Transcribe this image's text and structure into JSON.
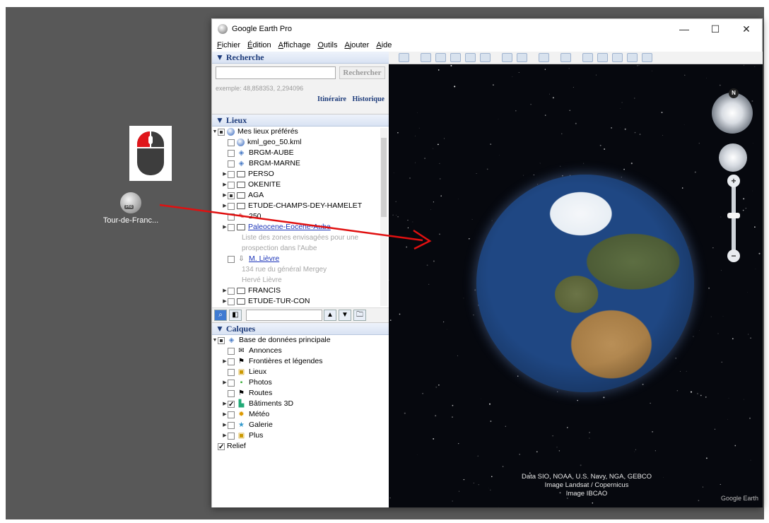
{
  "desktop": {
    "shortcut_label": "Tour-de-Franc...",
    "arrow_color": "#e01010"
  },
  "window": {
    "title": "Google Earth Pro",
    "controls": {
      "minimize": "—",
      "maximize": "☐",
      "close": "✕"
    },
    "menu": [
      "Fichier",
      "Édition",
      "Affichage",
      "Outils",
      "Ajouter",
      "Aide"
    ]
  },
  "search": {
    "header": "▼ Recherche",
    "input_value": "",
    "button": "Rechercher",
    "example": "exemple: 48,858353, 2,294096",
    "link_itinerary": "Itinéraire",
    "link_history": "Historique"
  },
  "places": {
    "header": "▼ Lieux",
    "items": [
      {
        "label": "Mes lieux préférés",
        "indent": 0,
        "toggle": "▼",
        "check": "full",
        "icon": "earth"
      },
      {
        "label": "kml_geo_50.kml",
        "indent": 1,
        "toggle": "",
        "check": "empty",
        "icon": "earth"
      },
      {
        "label": "BRGM-AUBE",
        "indent": 1,
        "toggle": "",
        "check": "empty",
        "icon": "layers"
      },
      {
        "label": "BRGM-MARNE",
        "indent": 1,
        "toggle": "",
        "check": "empty",
        "icon": "layers"
      },
      {
        "label": "PERSO",
        "indent": 1,
        "toggle": "▶",
        "check": "empty",
        "icon": "folder"
      },
      {
        "label": "OKENITE",
        "indent": 1,
        "toggle": "▶",
        "check": "empty",
        "icon": "folder"
      },
      {
        "label": "AGA",
        "indent": 1,
        "toggle": "▶",
        "check": "full",
        "icon": "folder"
      },
      {
        "label": "ETUDE-CHAMPS-DEY-HAMELET",
        "indent": 1,
        "toggle": "▶",
        "check": "empty",
        "icon": "folder"
      },
      {
        "label": "250",
        "indent": 1,
        "toggle": "",
        "check": "empty",
        "icon": "pin"
      },
      {
        "label": "Paleocene-Eocene-Aube",
        "indent": 1,
        "toggle": "▶",
        "check": "empty",
        "icon": "folder",
        "link": true
      },
      {
        "label": "Liste des zones envisagées pour une",
        "indent": 2,
        "sub": true
      },
      {
        "label": "prospection dans l'Aube",
        "indent": 2,
        "sub": true
      },
      {
        "label": "M. Lièvre",
        "indent": 1,
        "toggle": "",
        "check": "empty",
        "icon": "pushpin",
        "link": true
      },
      {
        "label": "134 rue du général Mergey",
        "indent": 2,
        "sub": true
      },
      {
        "label": "Hervé Lièvre",
        "indent": 2,
        "sub": true
      },
      {
        "label": "FRANCIS",
        "indent": 1,
        "toggle": "▶",
        "check": "empty",
        "icon": "folder"
      },
      {
        "label": "ETUDE-TUR-CON",
        "indent": 1,
        "toggle": "▶",
        "check": "empty",
        "icon": "folder"
      }
    ]
  },
  "layers": {
    "header": "▼ Calques",
    "items": [
      {
        "label": "Base de données principale",
        "indent": 0,
        "toggle": "▼",
        "check": "full",
        "icon": "layers"
      },
      {
        "label": "Annonces",
        "indent": 1,
        "toggle": "",
        "check": "empty",
        "icon": "mail"
      },
      {
        "label": "Frontières et légendes",
        "indent": 1,
        "toggle": "▶",
        "check": "empty",
        "icon": "flag"
      },
      {
        "label": "Lieux",
        "indent": 1,
        "toggle": "",
        "check": "empty",
        "icon": "square"
      },
      {
        "label": "Photos",
        "indent": 1,
        "toggle": "▶",
        "check": "empty",
        "icon": "photo"
      },
      {
        "label": "Routes",
        "indent": 1,
        "toggle": "",
        "check": "empty",
        "icon": "flag"
      },
      {
        "label": "Bâtiments 3D",
        "indent": 1,
        "toggle": "▶",
        "check": "checked",
        "icon": "building"
      },
      {
        "label": "Météo",
        "indent": 1,
        "toggle": "▶",
        "check": "empty",
        "icon": "sun"
      },
      {
        "label": "Galerie",
        "indent": 1,
        "toggle": "▶",
        "check": "empty",
        "icon": "star"
      },
      {
        "label": "Plus",
        "indent": 1,
        "toggle": "▶",
        "check": "empty",
        "icon": "square"
      },
      {
        "label": "Relief",
        "indent": 0,
        "toggle": "",
        "check": "checked",
        "icon": ""
      }
    ]
  },
  "map": {
    "compass_letter": "N",
    "zoom_plus": "+",
    "zoom_minus": "−",
    "credits": [
      "Data SIO, NOAA, U.S. Navy, NGA, GEBCO",
      "Image Landsat / Copernicus",
      "Image IBCAO"
    ],
    "watermark": "Google Earth"
  }
}
